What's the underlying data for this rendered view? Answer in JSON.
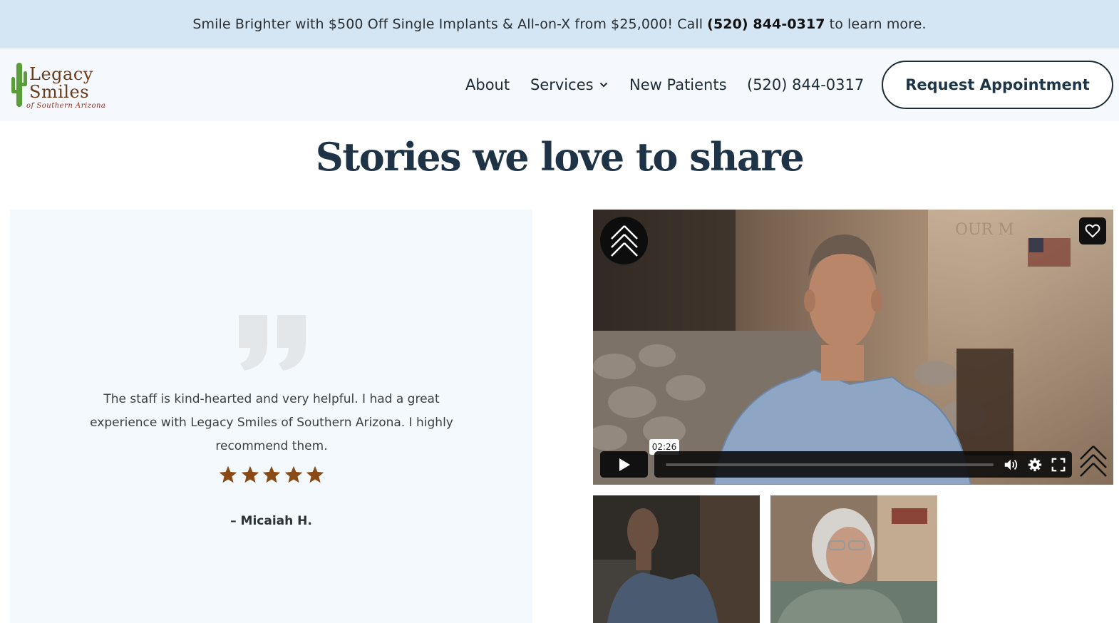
{
  "promo": {
    "text_before": "Smile Brighter with $500 Off Single Implants & All-on-X from $25,000! Call",
    "phone": "(520) 844-0317",
    "text_after": "to learn more."
  },
  "logo": {
    "line1": "Legacy",
    "line2": "Smiles",
    "line3": "of Southern Arizona",
    "icon": "cactus-icon"
  },
  "nav": {
    "about": "About",
    "services": "Services",
    "new_patients": "New Patients",
    "phone": "(520) 844-0317",
    "cta": "Request Appointment"
  },
  "section": {
    "title": "Stories we love to share"
  },
  "testimonial": {
    "quote": "The staff is kind-hearted and very helpful. I had a great experience with Legacy Smiles of Southern Arizona. I highly recommend them.",
    "rating": 5,
    "author": "– Micaiah H.",
    "star_color": "#8a4a16"
  },
  "video": {
    "time": "02:26",
    "progress": 0,
    "icons": [
      "play-icon",
      "volume-icon",
      "settings-icon",
      "fullscreen-icon",
      "heart-icon",
      "chevron-logo-icon"
    ]
  },
  "colors": {
    "promo_bg": "#d4e5f3",
    "header_bg": "#f5f9fd",
    "navy": "#1d2b36",
    "logo_brown": "#6b3a1a",
    "cactus_green": "#5a9e3a"
  }
}
